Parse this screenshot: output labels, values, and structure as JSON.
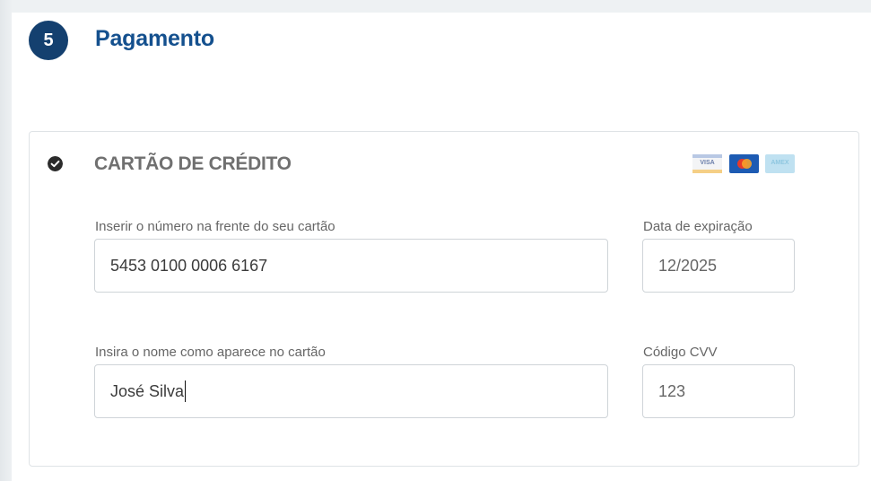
{
  "section": {
    "step_number": "5",
    "title": "Pagamento"
  },
  "payment_method": {
    "title": "CARTÃO DE CRÉDITO",
    "selected": true,
    "card_brand_icons": [
      "visa-icon",
      "mastercard-icon",
      "amex-icon"
    ],
    "visa_text": "VISA",
    "amex_text": "AMEX"
  },
  "form": {
    "card_number": {
      "label": "Inserir o número na frente do seu cartão",
      "value": "5453 0100 0006 6167"
    },
    "expiration": {
      "label": "Data de expiração",
      "value": "12/2025"
    },
    "card_name": {
      "label": "Insira o nome como aparece no cartão",
      "value": "José Silva"
    },
    "cvv": {
      "label": "Código CVV",
      "value": "123"
    }
  },
  "colors": {
    "badge": "#14406f",
    "title": "#14508e",
    "method_title": "#707070"
  }
}
